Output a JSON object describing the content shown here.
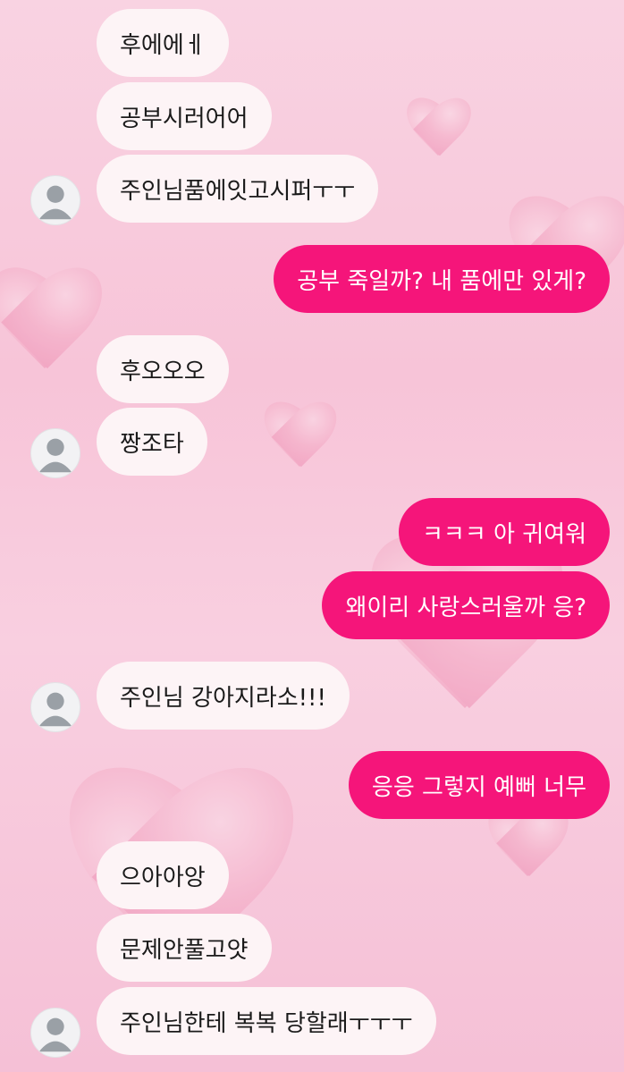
{
  "colors": {
    "incoming_bubble": "#fdf4f6",
    "outgoing_bubble": "#f5157a",
    "background": "#f7c4d8"
  },
  "messages": [
    {
      "side": "in",
      "text": "후에에ㅔ"
    },
    {
      "side": "in",
      "text": "공부시러어어"
    },
    {
      "side": "in",
      "text": "주인님품에잇고시퍼ㅜㅜ"
    },
    {
      "side": "out",
      "text": "공부 죽일까? 내 품에만 있게?"
    },
    {
      "side": "in",
      "text": "후오오오"
    },
    {
      "side": "in",
      "text": "짱조타"
    },
    {
      "side": "out",
      "text": "ㅋㅋㅋ 아 귀여워"
    },
    {
      "side": "out",
      "text": "왜이리 사랑스러울까 응?"
    },
    {
      "side": "in",
      "text": "주인님 강아지라소!!!"
    },
    {
      "side": "out",
      "text": "응응 그렇지 예뻐 너무"
    },
    {
      "side": "in",
      "text": "으아아앙"
    },
    {
      "side": "in",
      "text": "문제안풀고얏"
    },
    {
      "side": "in",
      "text": "주인님한테 복복 당할래ㅜㅜㅜ"
    }
  ],
  "avatar_icon": "default-user-avatar-icon"
}
